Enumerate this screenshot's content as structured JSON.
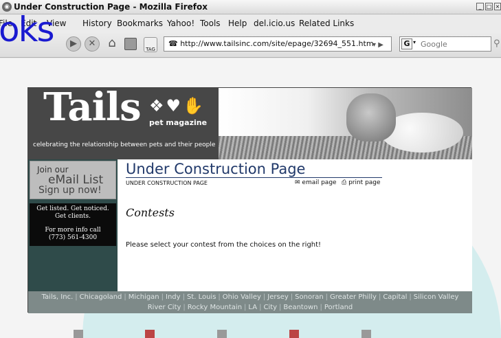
{
  "window": {
    "title": "Under Construction Page - Mozilla Firefox"
  },
  "menu": [
    "File",
    "Edit",
    "View",
    "History",
    "Bookmarks",
    "Yahoo!",
    "Tools",
    "Help",
    "del.icio.us",
    "Related Links"
  ],
  "toolbar": {
    "url": "http://www.tailsinc.com/site/epage/32694_551.htm",
    "tag_label": "TAG",
    "search_placeholder": "Google",
    "search_engine_letter": "G"
  },
  "overlay_text": "oks",
  "site": {
    "logo": "Tails",
    "logo_icons": "❖♥✋",
    "logo_sub": "pet magazine",
    "tagline": "celebrating the relationship between pets and their people",
    "join": {
      "line1": "Join our",
      "line2": "eMail List",
      "line3": "Sign up now!"
    },
    "promo": {
      "line1": "Get listed. Get noticed.",
      "line2": "Get clients.",
      "line3": "For more info call",
      "line4": "(773) 561-4300"
    },
    "page_title": "Under Construction Page",
    "breadcrumb": "UNDER CONSTRUCTION PAGE",
    "email_page": "email page",
    "print_page": "print page",
    "section_title": "Contests",
    "intro": "Please select your contest from the choices on the right!",
    "footer_row1": [
      "Tails, Inc.",
      "Chicagoland",
      "Michigan",
      "Indy",
      "St. Louis",
      "Ohio Valley",
      "Jersey",
      "Sonoran",
      "Greater Philly",
      "Capital",
      "Silicon Valley"
    ],
    "footer_row2": [
      "River City",
      "Rocky Mountain",
      "LA",
      "City",
      "Beantown",
      "Portland"
    ]
  },
  "colors": {
    "title_blue": "#21396a",
    "sidebar": "#2f4b4a",
    "footer": "#7e8a89",
    "overlay_blue": "#1a1ad0"
  }
}
